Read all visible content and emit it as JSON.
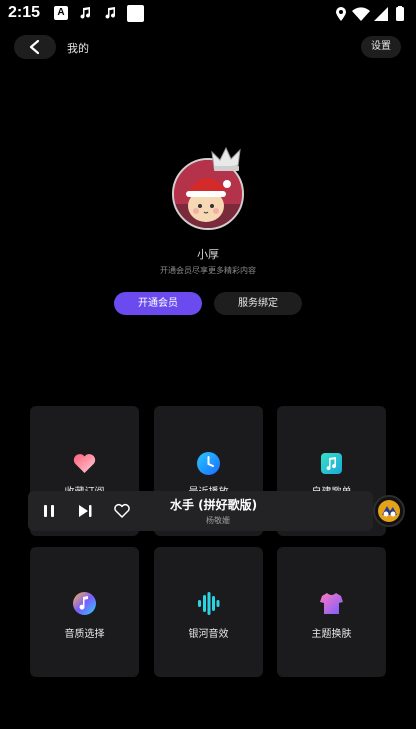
{
  "status_bar": {
    "time": "2:15",
    "notifications": [
      "a-icon",
      "music-note-icon",
      "music-note-icon",
      "square-icon"
    ],
    "right_icons": [
      "location-icon",
      "wifi-icon",
      "signal-icon",
      "battery-icon"
    ]
  },
  "header": {
    "title": "我的",
    "settings_label": "设置"
  },
  "profile": {
    "username": "小厚",
    "subtitle": "开通会员尽享更多精彩内容",
    "vip_button": "开通会员",
    "bind_button": "服务绑定"
  },
  "grid": {
    "items": [
      {
        "label": "收藏订阅",
        "icon": "heart-icon"
      },
      {
        "label": "最近播放",
        "icon": "clock-icon"
      },
      {
        "label": "自建歌单",
        "icon": "playlist-icon"
      },
      {
        "label": "音质选择",
        "icon": "music-quality-icon"
      },
      {
        "label": "银河音效",
        "icon": "sound-wave-icon"
      },
      {
        "label": "主题换肤",
        "icon": "tshirt-icon"
      }
    ]
  },
  "player": {
    "title": "水手 (拼好歌版)",
    "artist": "杨敬姗"
  },
  "colors": {
    "accent": "#6b4bf0",
    "card_bg": "#1b1b1d",
    "background": "#000000"
  }
}
